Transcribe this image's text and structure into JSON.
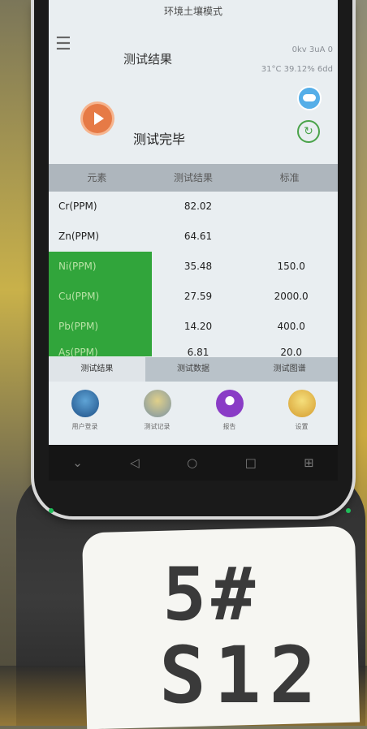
{
  "screen": {
    "top_title": "环境土壤模式",
    "header": {
      "menu_icon": "menu-icon",
      "title": "测试结果",
      "status_line1": "0kv 3uA 0",
      "status_line2": "31°C 39.12% 6dd"
    },
    "status": {
      "text": "测试完毕",
      "play_icon": "play-icon",
      "cloud_icon": "cloud-icon",
      "sync_icon": "sync-icon"
    },
    "table": {
      "headers": [
        "元素",
        "测试结果",
        "标准"
      ],
      "rows": [
        {
          "element": "Cr(PPM)",
          "result": "82.02",
          "standard": "",
          "highlight": false
        },
        {
          "element": "Zn(PPM)",
          "result": "64.61",
          "standard": "",
          "highlight": false
        },
        {
          "element": "Ni(PPM)",
          "result": "35.48",
          "standard": "150.0",
          "highlight": true
        },
        {
          "element": "Cu(PPM)",
          "result": "27.59",
          "standard": "2000.0",
          "highlight": true
        },
        {
          "element": "Pb(PPM)",
          "result": "14.20",
          "standard": "400.0",
          "highlight": true
        },
        {
          "element": "As(PPM)",
          "result": "6.81",
          "standard": "20.0",
          "highlight": true
        }
      ]
    },
    "tabs": [
      "测试结果",
      "测试数据",
      "测试图谱"
    ],
    "dock": [
      "用户登录",
      "测试记录",
      "报告",
      "设置"
    ]
  },
  "navbar": [
    "⌄",
    "◁",
    "○",
    "□",
    "⊞"
  ],
  "card": {
    "line1": "5#",
    "line2": "S12"
  }
}
